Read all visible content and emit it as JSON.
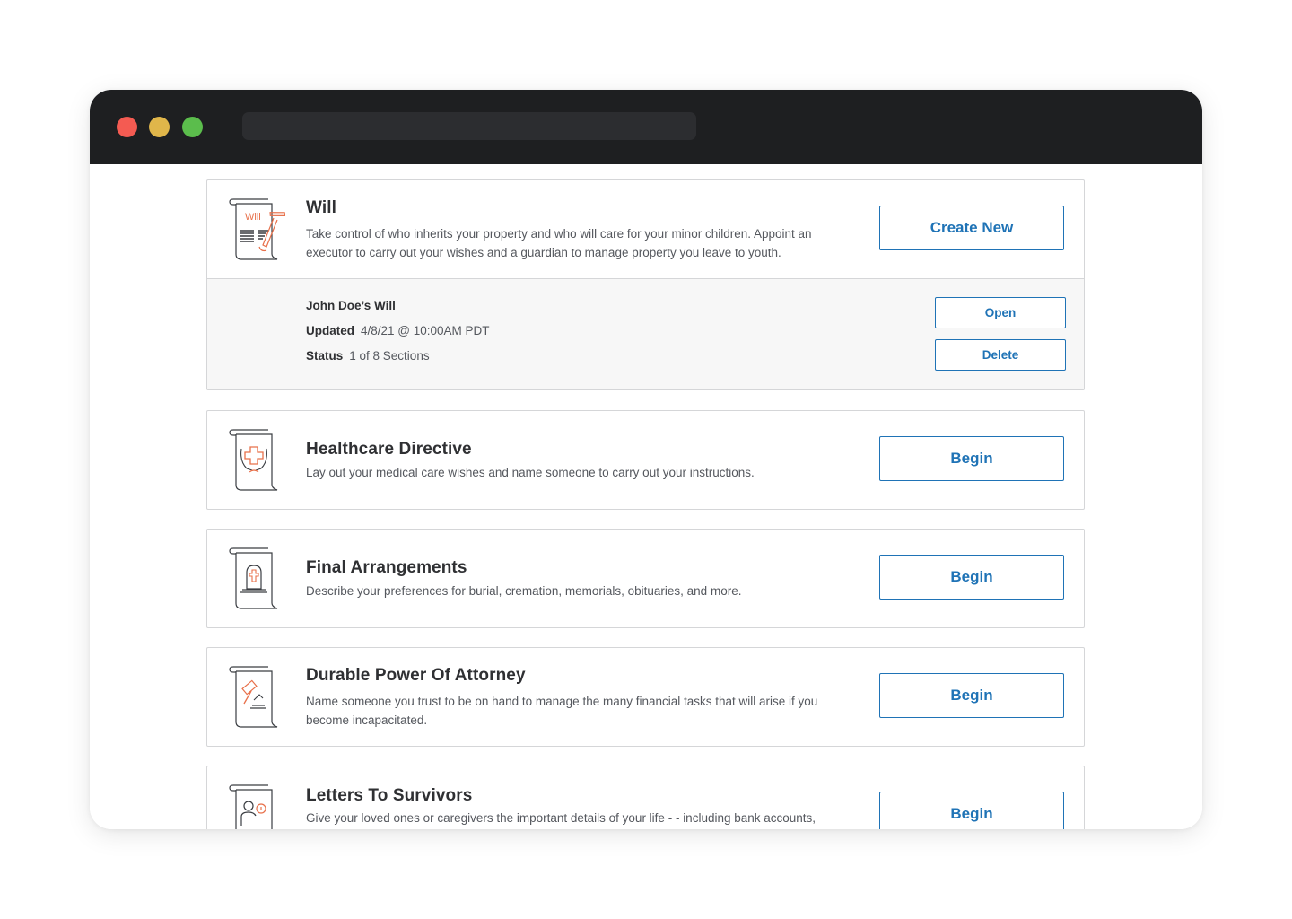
{
  "colors": {
    "accent": "#1f73b6",
    "icon_highlight": "#e8704a",
    "titlebar": "#1e1f21",
    "traffic_red": "#f45b52",
    "traffic_yellow": "#e0b64a",
    "traffic_green": "#5bbd4c"
  },
  "cards": [
    {
      "icon": "will-document-icon",
      "icon_text": "Will",
      "title": "Will",
      "description": "Take control of who inherits your property and who will care for your minor children. Appoint an executor to carry out your wishes and a guardian to manage property you leave to youth.",
      "button_label": "Create New",
      "documents": [
        {
          "name": "John Doe’s Will",
          "updated_label": "Updated",
          "updated_value": "4/8/21 @ 10:00AM PDT",
          "status_label": "Status",
          "status_value": "1 of 8 Sections",
          "open_label": "Open",
          "delete_label": "Delete"
        }
      ]
    },
    {
      "icon": "healthcare-hands-cross-icon",
      "title": "Healthcare Directive",
      "description": "Lay out your medical care wishes and name someone to carry out your instructions.",
      "button_label": "Begin"
    },
    {
      "icon": "tombstone-icon",
      "title": "Final Arrangements",
      "description": "Describe your preferences for burial, cremation, memorials, obituaries, and more.",
      "button_label": "Begin"
    },
    {
      "icon": "gavel-icon",
      "title": "Durable Power Of Attorney",
      "description": "Name someone you trust to be on hand to manage the many financial tasks that will arise if you become incapacitated.",
      "button_label": "Begin"
    },
    {
      "icon": "person-info-icon",
      "title": "Letters To Survivors",
      "description": "Give your loved ones or caregivers the important details of your life - - including bank accounts,",
      "button_label": "Begin"
    }
  ]
}
